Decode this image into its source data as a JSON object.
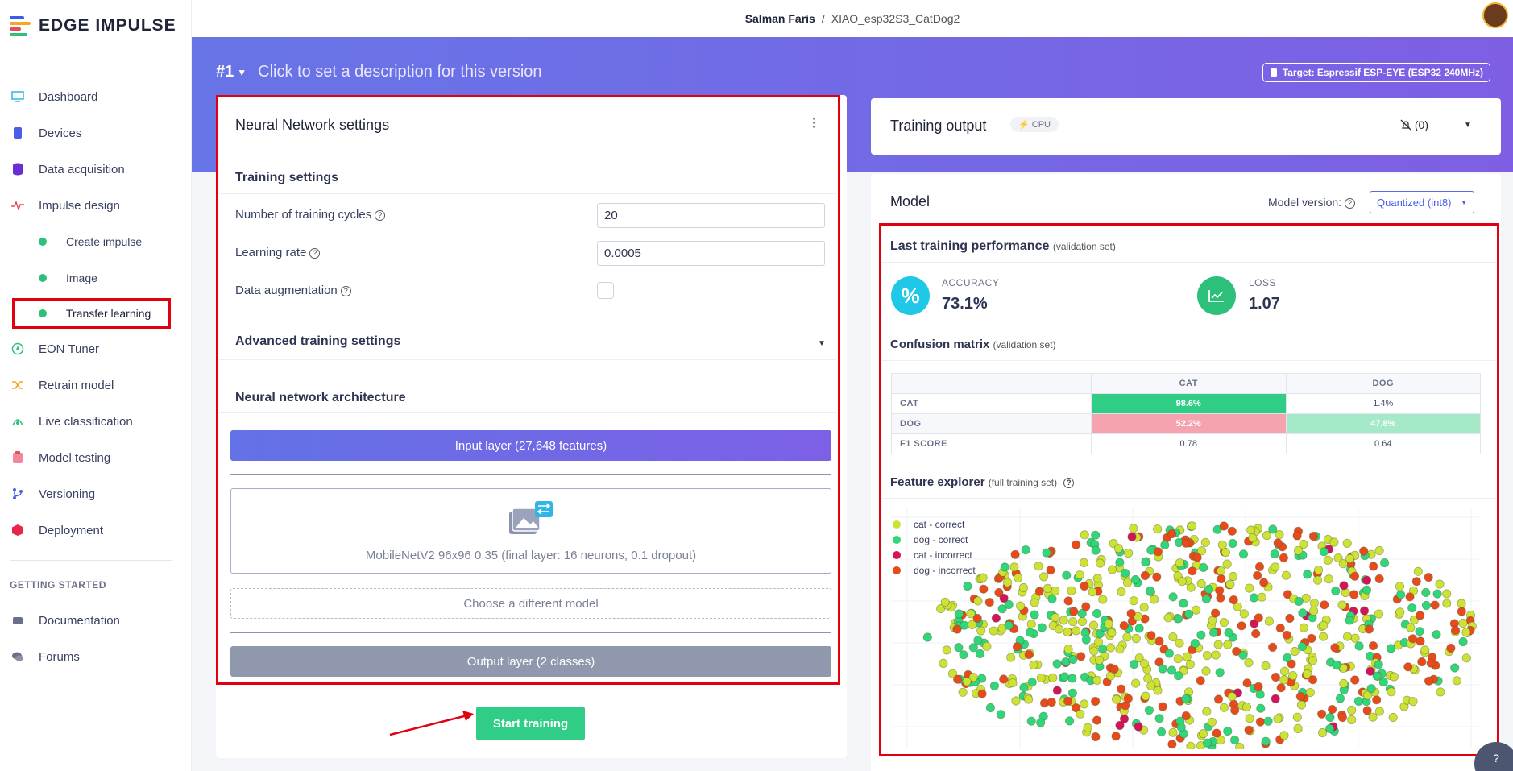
{
  "app": {
    "logo_text": "EDGE IMPULSE"
  },
  "sidebar": {
    "items": [
      {
        "label": "Dashboard",
        "icon": "monitor-icon"
      },
      {
        "label": "Devices",
        "icon": "chip-icon"
      },
      {
        "label": "Data acquisition",
        "icon": "database-icon"
      },
      {
        "label": "Impulse design",
        "icon": "pulse-icon"
      },
      {
        "label": "Create impulse"
      },
      {
        "label": "Image"
      },
      {
        "label": "Transfer learning"
      },
      {
        "label": "EON Tuner",
        "icon": "compass-icon"
      },
      {
        "label": "Retrain model",
        "icon": "shuffle-icon"
      },
      {
        "label": "Live classification",
        "icon": "live-icon"
      },
      {
        "label": "Model testing",
        "icon": "clipboard-icon"
      },
      {
        "label": "Versioning",
        "icon": "branch-icon"
      },
      {
        "label": "Deployment",
        "icon": "box-icon"
      }
    ],
    "getting_started_title": "GETTING STARTED",
    "getting_started": [
      {
        "label": "Documentation",
        "icon": "doc-icon"
      },
      {
        "label": "Forums",
        "icon": "chat-icon"
      }
    ]
  },
  "topbar": {
    "user": "Salman Faris",
    "separator": "/",
    "project": "XIAO_esp32S3_CatDog2"
  },
  "version": {
    "number": "#1",
    "description": "Click to set a description for this version"
  },
  "target": {
    "label": "Target: Espressif ESP-EYE (ESP32 240MHz)"
  },
  "nn_settings": {
    "title": "Neural Network settings",
    "training_settings_title": "Training settings",
    "cycles_label": "Number of training cycles",
    "cycles_value": "20",
    "lr_label": "Learning rate",
    "lr_value": "0.0005",
    "augmentation_label": "Data augmentation",
    "augmentation_checked": false,
    "advanced_title": "Advanced training settings",
    "architecture_title": "Neural network architecture",
    "input_layer": "Input layer (27,648 features)",
    "model_desc": "MobileNetV2 96x96 0.35 (final layer: 16 neurons, 0.1 dropout)",
    "choose_model": "Choose a different model",
    "output_layer": "Output layer (2 classes)",
    "start_training": "Start training"
  },
  "training_output": {
    "title": "Training output",
    "cpu_badge": "CPU",
    "notif_count": "(0)"
  },
  "model": {
    "title": "Model",
    "version_label": "Model version:",
    "version_value": "Quantized (int8)",
    "perf_title": "Last training performance",
    "perf_sub": "(validation set)",
    "accuracy_label": "ACCURACY",
    "accuracy_value": "73.1%",
    "loss_label": "LOSS",
    "loss_value": "1.07",
    "confusion_title": "Confusion matrix",
    "confusion_sub": "(validation set)",
    "confusion": {
      "columns": [
        "CAT",
        "DOG"
      ],
      "rows": [
        {
          "label": "CAT",
          "values": [
            "98.6%",
            "1.4%"
          ]
        },
        {
          "label": "DOG",
          "values": [
            "52.2%",
            "47.8%"
          ]
        },
        {
          "label": "F1 SCORE",
          "values": [
            "0.78",
            "0.64"
          ]
        }
      ]
    },
    "feature_title": "Feature explorer",
    "feature_sub": "(full training set)",
    "legend": [
      {
        "label": "cat - correct",
        "color": "#cde234"
      },
      {
        "label": "dog - correct",
        "color": "#2fd67a"
      },
      {
        "label": "cat - incorrect",
        "color": "#d4145a"
      },
      {
        "label": "dog - incorrect",
        "color": "#e84a1c"
      }
    ]
  },
  "colors": {
    "accent": "#2fcd86",
    "hero_start": "#6775e6",
    "hero_end": "#7e5fe4",
    "highlight": "#e0000f",
    "cm_good": "#2fcd86",
    "cm_bad": "#f6a3b0",
    "cm_mid": "#a6e9c9"
  },
  "help": {
    "label": "?"
  }
}
